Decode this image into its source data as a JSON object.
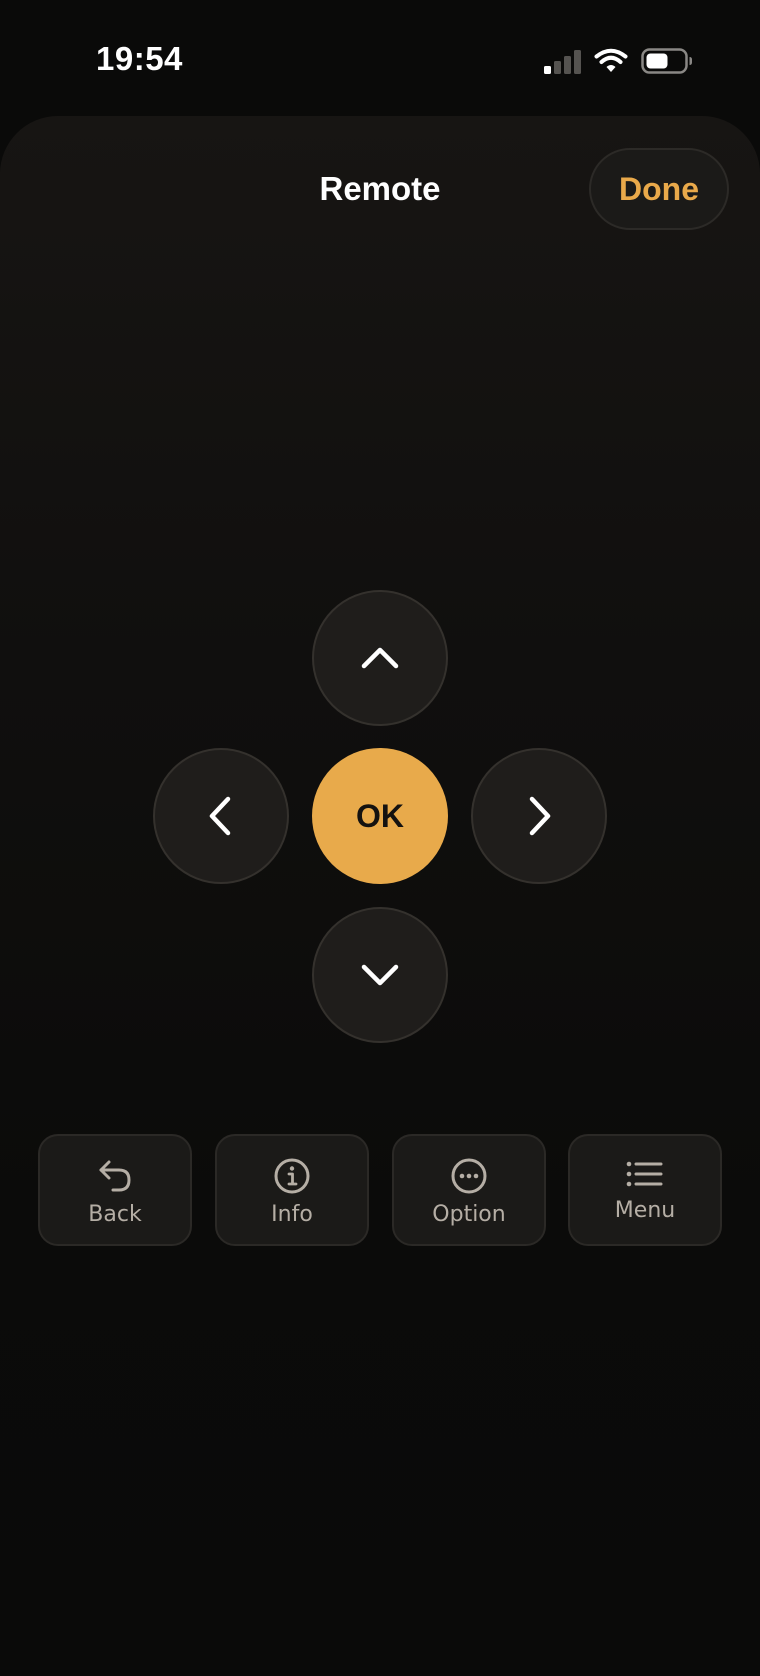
{
  "status_bar": {
    "time": "19:54"
  },
  "header": {
    "title": "Remote",
    "done_label": "Done"
  },
  "dpad": {
    "ok_label": "OK"
  },
  "actions": [
    {
      "label": "Back",
      "icon": "back-arrow-icon"
    },
    {
      "label": "Info",
      "icon": "info-icon"
    },
    {
      "label": "Option",
      "icon": "more-icon"
    },
    {
      "label": "Menu",
      "icon": "list-icon"
    }
  ],
  "colors": {
    "accent": "#e8aa4b",
    "background": "#0a0a09",
    "button_fill": "#1f1d1b",
    "action_label": "#b5aea5"
  }
}
